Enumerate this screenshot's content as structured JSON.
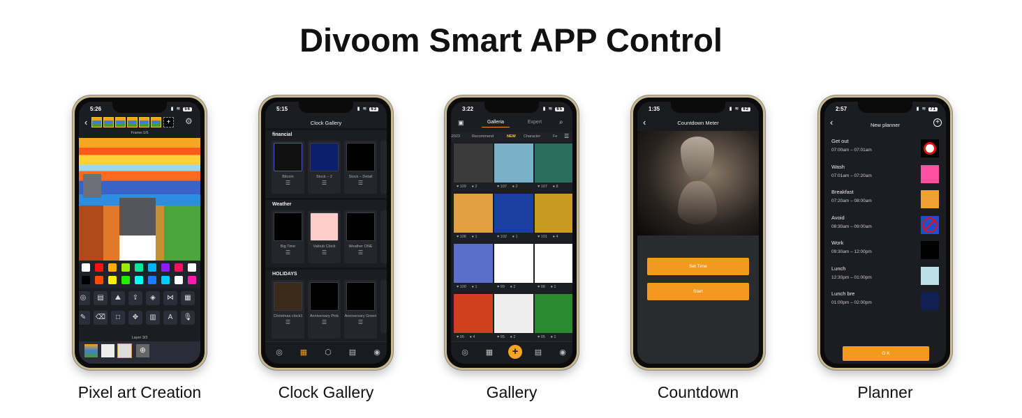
{
  "title": "Divoom Smart APP Control",
  "accent": "#f39a1e",
  "phones": [
    {
      "caption": "Pixel art Creation",
      "time": "5:26",
      "battery": "56",
      "frame_label": "Frame:1/6",
      "layer_label": "Layer 3/3",
      "palette": [
        [
          "#ffffff",
          "#ff1010",
          "#ffb000",
          "#99ee00",
          "#00e89a",
          "#00b4ff",
          "#8a1cff",
          "#ff1060",
          "#ffffff"
        ],
        [
          "#000000",
          "#ff4a00",
          "#ffee00",
          "#22ee00",
          "#00ffff",
          "#1a7cff",
          "#00ccff",
          "#ffffff",
          "#ff18b0"
        ]
      ],
      "tools": [
        [
          "◎",
          "▤",
          "⛰",
          "⇪",
          "◈",
          "⋈",
          "▦"
        ],
        [
          "✎",
          "⌫",
          "□",
          "✥",
          "▥",
          "A",
          "🎙"
        ]
      ]
    },
    {
      "caption": "Clock Gallery",
      "time": "5:15",
      "battery": "63",
      "header": "Clock Gallery",
      "sections": [
        {
          "title": "financial",
          "cards": [
            "Bitcoin",
            "Stock – 2",
            "Stock – Detail"
          ]
        },
        {
          "title": "Weather",
          "cards": [
            "Big Time",
            "Valoub Clock",
            "Weather ONE"
          ]
        },
        {
          "title": "HOLIDAYS",
          "cards": [
            "Christmas clock1",
            "Anniversary Pink",
            "Anniversary Green"
          ]
        }
      ]
    },
    {
      "caption": "Gallery",
      "time": "3:22",
      "battery": "65",
      "tabs": [
        "Galleria",
        "Expert"
      ],
      "categories": [
        "s2023",
        "Recommend",
        "NEW",
        "Character",
        "Fe"
      ],
      "tiles": [
        [
          "109",
          "2"
        ],
        [
          "107",
          "2"
        ],
        [
          "107",
          "8"
        ],
        [
          "106",
          "1"
        ],
        [
          "102",
          "1"
        ],
        [
          "101",
          "4"
        ],
        [
          "100",
          "1"
        ],
        [
          "99",
          "2"
        ],
        [
          "98",
          "1"
        ],
        [
          "95",
          "4"
        ],
        [
          "95",
          "2"
        ],
        [
          "95",
          "1"
        ]
      ]
    },
    {
      "caption": "Countdown",
      "time": "1:35",
      "battery": "62",
      "header": "Countdown Meter",
      "buttons": [
        "Set Time",
        "Start"
      ]
    },
    {
      "caption": "Planner",
      "time": "2:57",
      "battery": "71",
      "header": "New planner",
      "ok": "O K",
      "items": [
        {
          "name": "Get out",
          "time": "07:00am – 07:01am",
          "icon": "alarm-clock-icon"
        },
        {
          "name": "Wash",
          "time": "07:01am – 07:20am",
          "icon": "girl-brushing-icon"
        },
        {
          "name": "Breakfast",
          "time": "07:20am – 08:00am",
          "icon": "burger-icon"
        },
        {
          "name": "Avoid",
          "time": "08:30am – 09:00am",
          "icon": "no-parking-icon"
        },
        {
          "name": "Work",
          "time": "09:30am – 12:00pm",
          "icon": "office-worker-icon"
        },
        {
          "name": "Lunch",
          "time": "12:30pm – 01:00pm",
          "icon": "sandwich-icon"
        },
        {
          "name": "Lunch bre",
          "time": "01:00pm – 02:00pm",
          "icon": "night-scene-icon"
        }
      ]
    }
  ]
}
